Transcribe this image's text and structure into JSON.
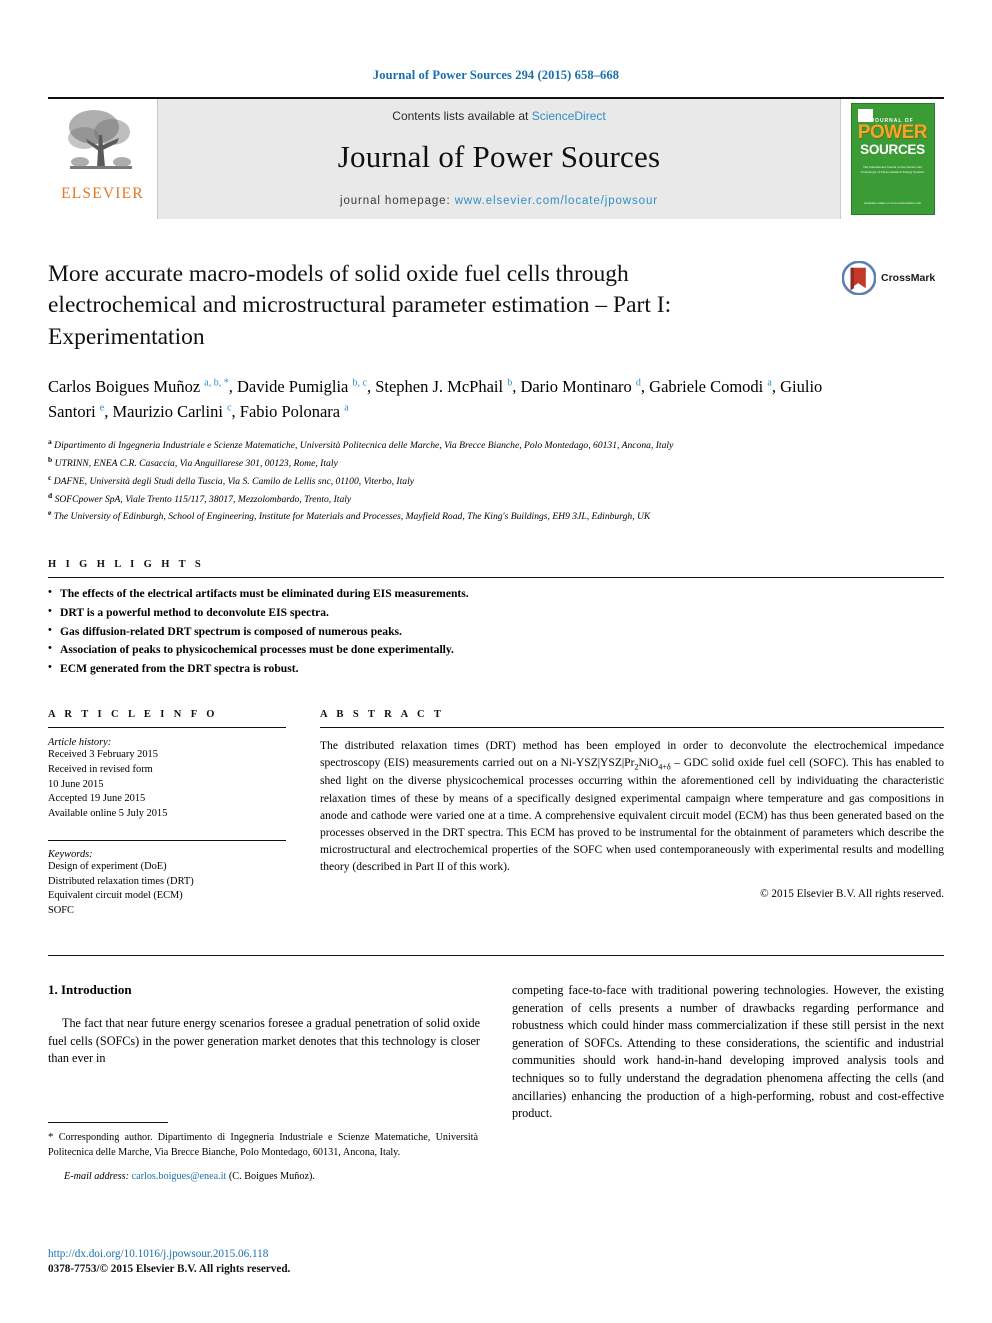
{
  "running_head": "Journal of Power Sources 294 (2015) 658–668",
  "masthead": {
    "contents_prefix": "Contents lists available at ",
    "sciencedirect": "ScienceDirect",
    "journal_name": "Journal of Power Sources",
    "homepage_prefix": "journal homepage: ",
    "homepage_url": "www.elsevier.com/locate/jpowsour",
    "publisher": "ELSEVIER",
    "cover": {
      "journal_of": "JOURNAL OF",
      "power": "POWER",
      "sources": "SOURCES",
      "subtitle": "The International Journal on the Science and Technology of Electrochemical Energy Systems",
      "footer": "Available online at www.sciencedirect.com"
    },
    "accent_blue": "#2f8ec4",
    "elsevier_orange": "#e87722",
    "cover_green": "#3b9b35"
  },
  "article": {
    "title": "More accurate macro-models of solid oxide fuel cells through electrochemical and microstructural parameter estimation – Part I: Experimentation",
    "crossmark_label": "CrossMark",
    "authors": [
      {
        "name": "Carlos Boigues Muñoz",
        "marks": "a, b, *"
      },
      {
        "name": "Davide Pumiglia",
        "marks": "b, c"
      },
      {
        "name": "Stephen J. McPhail",
        "marks": "b"
      },
      {
        "name": "Dario Montinaro",
        "marks": "d"
      },
      {
        "name": "Gabriele Comodi",
        "marks": "a"
      },
      {
        "name": "Giulio Santori",
        "marks": "e"
      },
      {
        "name": "Maurizio Carlini",
        "marks": "c"
      },
      {
        "name": "Fabio Polonara",
        "marks": "a"
      }
    ],
    "affiliations": [
      {
        "mark": "a",
        "text": "Dipartimento di Ingegneria Industriale e Scienze Matematiche, Università Politecnica delle Marche, Via Brecce Bianche, Polo Montedago, 60131, Ancona, Italy"
      },
      {
        "mark": "b",
        "text": "UTRINN, ENEA C.R. Casaccia, Via Anguillarese 301, 00123, Rome, Italy"
      },
      {
        "mark": "c",
        "text": "DAFNE, Università degli Studi della Tuscia, Via S. Camilo de Lellis snc, 01100, Viterbo, Italy"
      },
      {
        "mark": "d",
        "text": "SOFCpower SpA, Viale Trento 115/117, 38017, Mezzolombardo, Trento, Italy"
      },
      {
        "mark": "e",
        "text": "The University of Edinburgh, School of Engineering, Institute for Materials and Processes, Mayfield Road, The King's Buildings, EH9 3JL, Edinburgh, UK"
      }
    ]
  },
  "highlights": {
    "heading": "H I G H L I G H T S",
    "items": [
      "The effects of the electrical artifacts must be eliminated during EIS measurements.",
      "DRT is a powerful method to deconvolute EIS spectra.",
      "Gas diffusion-related DRT spectrum is composed of numerous peaks.",
      "Association of peaks to physicochemical processes must be done experimentally.",
      "ECM generated from the DRT spectra is robust."
    ]
  },
  "article_info": {
    "heading": "A R T I C L E   I N F O",
    "history_label": "Article history:",
    "history": [
      "Received 3 February 2015",
      "Received in revised form",
      "10 June 2015",
      "Accepted 19 June 2015",
      "Available online 5 July 2015"
    ],
    "keywords_label": "Keywords:",
    "keywords": [
      "Design of experiment (DoE)",
      "Distributed relaxation times (DRT)",
      "Equivalent circuit model (ECM)",
      "SOFC"
    ]
  },
  "abstract": {
    "heading": "A B S T R A C T",
    "part1": "The distributed relaxation times (DRT) method has been employed in order to deconvolute the electrochemical impedance spectroscopy (EIS) measurements carried out on a Ni-YSZ|YSZ|Pr",
    "formula_sub1": "2",
    "formula_mid": "NiO",
    "formula_sub2": "4+δ",
    "part2": " – GDC solid oxide fuel cell (SOFC). This has enabled to shed light on the diverse physicochemical processes occurring within the aforementioned cell by individuating the characteristic relaxation times of these by means of a specifically designed experimental campaign where temperature and gas compositions in anode and cathode were varied one at a time. A comprehensive equivalent circuit model (ECM) has thus been generated based on the processes observed in the DRT spectra. This ECM has proved to be instrumental for the obtainment of parameters which describe the microstructural and electrochemical properties of the SOFC when used contemporaneously with experimental results and modelling theory (described in Part II of this work).",
    "copyright": "© 2015 Elsevier B.V. All rights reserved."
  },
  "body": {
    "section_number_title": "1. Introduction",
    "left_para": "The fact that near future energy scenarios foresee a gradual penetration of solid oxide fuel cells (SOFCs) in the power generation market denotes that this technology is closer than ever in",
    "right_para": "competing face-to-face with traditional powering technologies. However, the existing generation of cells presents a number of drawbacks regarding performance and robustness which could hinder mass commercialization if these still persist in the next generation of SOFCs. Attending to these considerations, the scientific and industrial communities should work hand-in-hand developing improved analysis tools and techniques so to fully understand the degradation phenomena affecting the cells (and ancillaries) enhancing the production of a high-performing, robust and cost-effective product."
  },
  "footer": {
    "corresponding_star": "*",
    "corresponding_text": "Corresponding author. Dipartimento di Ingegneria Industriale e Scienze Matematiche, Università Politecnica delle Marche, Via Brecce Bianche, Polo Montedago, 60131, Ancona, Italy.",
    "email_label": "E-mail address:",
    "email": "carlos.boigues@enea.it",
    "email_owner": "(C. Boigues Muñoz).",
    "doi": "http://dx.doi.org/10.1016/j.jpowsour.2015.06.118",
    "issn": "0378-7753/© 2015 Elsevier B.V. All rights reserved."
  }
}
